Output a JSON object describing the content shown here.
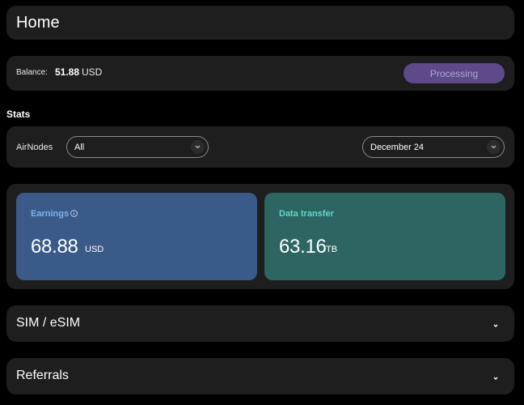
{
  "header": {
    "title": "Home"
  },
  "balance": {
    "label": "Balance:",
    "amount": "51.88",
    "currency": "USD",
    "status_button": "Processing"
  },
  "stats": {
    "heading": "Stats",
    "filter_label": "AirNodes",
    "airnodes_select": {
      "value": "All",
      "icon": "chevron-down-icon"
    },
    "date_select": {
      "value": "December 24",
      "icon": "chevron-down-icon"
    }
  },
  "metrics": {
    "earnings": {
      "title": "Earnings",
      "value": "68.88",
      "unit": "USD",
      "icon": "info-icon"
    },
    "transfer": {
      "title": "Data transfer",
      "value": "63.16",
      "unit": "TB"
    }
  },
  "sections": {
    "sim": {
      "title": "SIM / eSIM",
      "icon": "chevron-down-icon"
    },
    "referrals": {
      "title": "Referrals",
      "icon": "chevron-down-icon"
    }
  },
  "colors": {
    "background": "#000000",
    "card": "#1e1e1e",
    "processing_button": "#5c4a8a",
    "earnings_tile": "#3a5a8a",
    "earnings_title": "#7fb3f0",
    "transfer_tile": "#2d6562",
    "transfer_title": "#5fd8d0"
  }
}
